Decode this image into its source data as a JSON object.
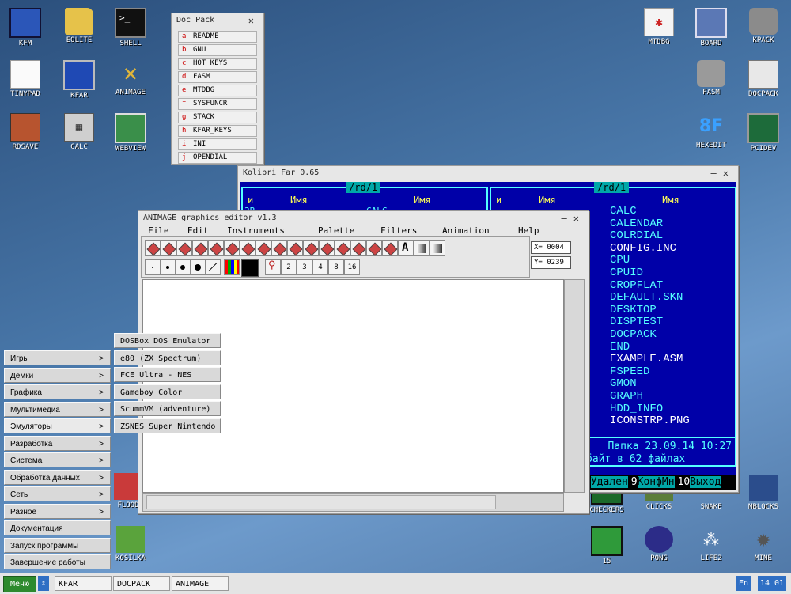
{
  "desktop": {
    "icons": [
      {
        "id": "kfm",
        "label": "KFM"
      },
      {
        "id": "eolite",
        "label": "EOLITE"
      },
      {
        "id": "shell",
        "label": "SHELL"
      },
      {
        "id": "tinypad",
        "label": "TINYPAD"
      },
      {
        "id": "kfar",
        "label": "KFAR"
      },
      {
        "id": "animage",
        "label": "ANIMAGE"
      },
      {
        "id": "rdsave",
        "label": "RDSAVE"
      },
      {
        "id": "calc",
        "label": "CALC"
      },
      {
        "id": "webview",
        "label": "WEBVIEW"
      },
      {
        "id": "mtdbg",
        "label": "MTDBG"
      },
      {
        "id": "board",
        "label": "BOARD"
      },
      {
        "id": "kpack",
        "label": "KPACK"
      },
      {
        "id": "fasm",
        "label": "FASM"
      },
      {
        "id": "docpack",
        "label": "DOCPACK"
      },
      {
        "id": "hexedit",
        "label": "HEXEDIT"
      },
      {
        "id": "pcidev",
        "label": "PCIDEV"
      },
      {
        "id": "flood",
        "label": "FLOOD"
      },
      {
        "id": "kosilka",
        "label": "KOSILKA"
      },
      {
        "id": "checkers",
        "label": "CHECKERS"
      },
      {
        "id": "clicks",
        "label": "CLICKS"
      },
      {
        "id": "snake",
        "label": "SNAKE"
      },
      {
        "id": "mblocks",
        "label": "MBLOCKS"
      },
      {
        "id": "15",
        "label": "15"
      },
      {
        "id": "pong",
        "label": "PONG"
      },
      {
        "id": "life2",
        "label": "LIFE2"
      },
      {
        "id": "mine",
        "label": "MINE"
      }
    ]
  },
  "docpack": {
    "title": "Doc Pack",
    "items": [
      {
        "key": "a",
        "label": "README"
      },
      {
        "key": "b",
        "label": "GNU"
      },
      {
        "key": "c",
        "label": "HOT_KEYS"
      },
      {
        "key": "d",
        "label": "FASM"
      },
      {
        "key": "e",
        "label": "MTDBG"
      },
      {
        "key": "f",
        "label": "SYSFUNCR"
      },
      {
        "key": "g",
        "label": "STACK"
      },
      {
        "key": "h",
        "label": "KFAR_KEYS"
      },
      {
        "key": "i",
        "label": "INI"
      },
      {
        "key": "j",
        "label": "OPENDIAL"
      }
    ]
  },
  "kfar": {
    "title": "Kolibri Far 0.65",
    "left_path": "/rd/1",
    "right_path": "/rd/1",
    "col_n": "и",
    "col_name": "Имя",
    "left_partial": "ЗВ",
    "mid_partial": "CALC",
    "files": [
      {
        "name": "CALC",
        "color": "cyan"
      },
      {
        "name": "CALENDAR",
        "color": "cyan"
      },
      {
        "name": "COLRDIAL",
        "color": "cyan"
      },
      {
        "name": "CONFIG.INC",
        "color": "white"
      },
      {
        "name": "CPU",
        "color": "cyan"
      },
      {
        "name": "CPUID",
        "color": "cyan"
      },
      {
        "name": "CROPFLAT",
        "color": "cyan"
      },
      {
        "name": "DEFAULT.SKN",
        "color": "cyan"
      },
      {
        "name": "DESKTOP",
        "color": "cyan"
      },
      {
        "name": "DISPTEST",
        "color": "cyan"
      },
      {
        "name": "DOCPACK",
        "color": "cyan"
      },
      {
        "name": "END",
        "color": "cyan"
      },
      {
        "name": "EXAMPLE.ASM",
        "color": "white"
      },
      {
        "name": "FSPEED",
        "color": "cyan"
      },
      {
        "name": "GMON",
        "color": "cyan"
      },
      {
        "name": "GRAPH",
        "color": "cyan"
      },
      {
        "name": "HDD_INFO",
        "color": "cyan"
      },
      {
        "name": "ICONSTRP.PNG",
        "color": "white"
      }
    ],
    "status1": "Папка 23.09.14 10:27",
    "status2": "байт в 62 файлах",
    "keys": [
      {
        "n": "8",
        "t": "Удален"
      },
      {
        "n": "9",
        "t": "КонфМн"
      },
      {
        "n": "10",
        "t": "Выход"
      }
    ]
  },
  "animage": {
    "title": "ANIMAGE graphics editor v1.3",
    "menu": [
      "File",
      "Edit",
      "Instruments",
      "Palette",
      "Filters",
      "Animation",
      "Help"
    ],
    "x_coord": "X= 0004",
    "y_coord": "Y= 0239",
    "zoom_levels": [
      "2",
      "3",
      "4",
      "8",
      "16"
    ],
    "text_tool": "A"
  },
  "start_menu": {
    "items": [
      {
        "label": "Игры",
        "arrow": ">"
      },
      {
        "label": "Демки",
        "arrow": ">"
      },
      {
        "label": "Графика",
        "arrow": ">"
      },
      {
        "label": "Мультимедиа",
        "arrow": ">"
      },
      {
        "label": "Эмуляторы",
        "arrow": ">"
      },
      {
        "label": "Разработка",
        "arrow": ">"
      },
      {
        "label": "Система",
        "arrow": ">"
      },
      {
        "label": "Обработка данных",
        "arrow": ">"
      },
      {
        "label": "Сеть",
        "arrow": ">"
      },
      {
        "label": "Разное",
        "arrow": ">"
      },
      {
        "label": "Документация",
        "arrow": ""
      },
      {
        "label": "Запуск программы",
        "arrow": ""
      },
      {
        "label": "Завершение работы",
        "arrow": ""
      }
    ],
    "submenu": [
      "DOSBox DOS Emulator",
      "e80 (ZX Spectrum)",
      "FCE Ultra - NES",
      "Gameboy Color",
      "ScummVM (adventure)",
      "ZSNES Super Nintendo"
    ]
  },
  "taskbar": {
    "menu_label": "Меню",
    "tasks": [
      "KFAR",
      "DOCPACK",
      "ANIMAGE"
    ],
    "lang": "En",
    "clock": "14 01"
  }
}
